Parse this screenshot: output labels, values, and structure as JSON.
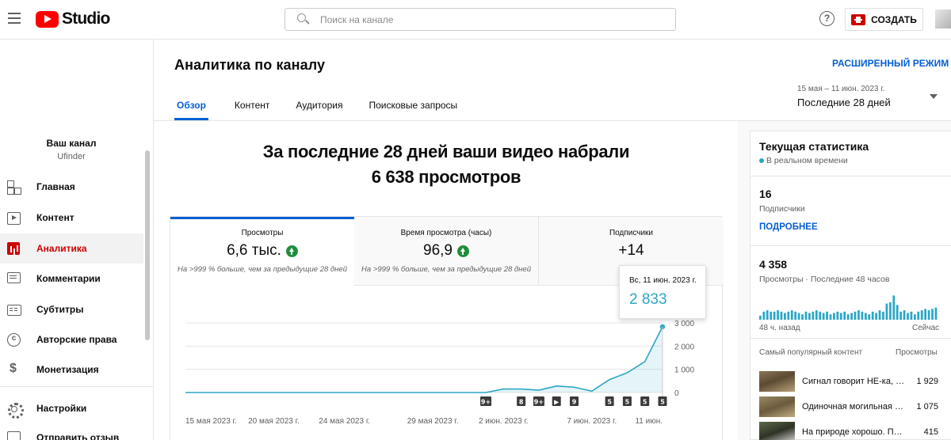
{
  "topbar": {
    "logo_text": "Studio",
    "search_placeholder": "Поиск на канале",
    "help_icon": "?",
    "create_label": "СОЗДАТЬ"
  },
  "sidebar": {
    "channel_name": "Ваш канал",
    "channel_handle": "Ufinder",
    "items": [
      {
        "label": "Главная",
        "icon": "home-icon"
      },
      {
        "label": "Контент",
        "icon": "content-icon"
      },
      {
        "label": "Аналитика",
        "icon": "analytics-icon",
        "active": true
      },
      {
        "label": "Комментарии",
        "icon": "comments-icon"
      },
      {
        "label": "Субтитры",
        "icon": "subtitles-icon"
      },
      {
        "label": "Авторские права",
        "icon": "copyright-icon"
      },
      {
        "label": "Монетизация",
        "icon": "monetization-icon"
      },
      {
        "label": "Настройки",
        "icon": "gear-icon"
      },
      {
        "label": "Отправить отзыв",
        "icon": "feedback-icon"
      }
    ]
  },
  "header": {
    "title": "Аналитика по каналу",
    "advanced_link": "РАСШИРЕННЫЙ РЕЖИМ",
    "tabs": [
      "Обзор",
      "Контент",
      "Аудитория",
      "Поисковые запросы"
    ],
    "date_range": "15 мая – 11 июн. 2023 г.",
    "period": "Последние 28 дней"
  },
  "overview": {
    "headline_line1": "За последние 28 дней ваши видео набрали",
    "headline_line2": "6 638 просмотров",
    "metrics": [
      {
        "title": "Просмотры",
        "value": "6,6 тыс.",
        "trend": "up",
        "compare": "На >999 % больше, чем за предыдущие 28 дней"
      },
      {
        "title": "Время просмотра (часы)",
        "value": "96,9",
        "trend": "up",
        "compare": "На >999 % больше, чем за предыдущие 28 дней"
      },
      {
        "title": "Подписчики",
        "value": "+14"
      }
    ],
    "tooltip": {
      "date": "Вс, 11 июн. 2023 г.",
      "value": "2 833"
    }
  },
  "chart_data": {
    "type": "area",
    "x": [
      "15 мая",
      "16 мая",
      "17 мая",
      "18 мая",
      "19 мая",
      "20 мая",
      "21 мая",
      "22 мая",
      "23 мая",
      "24 мая",
      "25 мая",
      "26 мая",
      "27 мая",
      "28 мая",
      "29 мая",
      "30 мая",
      "31 мая",
      "1 июн.",
      "2 июн.",
      "3 июн.",
      "4 июн.",
      "5 июн.",
      "6 июн.",
      "7 июн.",
      "8 июн.",
      "9 июн.",
      "10 июн.",
      "11 июн."
    ],
    "values": [
      0,
      0,
      0,
      0,
      0,
      0,
      0,
      0,
      0,
      0,
      0,
      0,
      0,
      0,
      0,
      0,
      0,
      0,
      150,
      150,
      100,
      280,
      230,
      60,
      560,
      850,
      1330,
      2833
    ],
    "ylim": [
      0,
      3000
    ],
    "y_ticks": [
      "0",
      "1 000",
      "2 000",
      "3 000"
    ],
    "x_tick_labels": [
      "15 мая 2023 г.",
      "20 мая 2023 г.",
      "24 мая 2023 г.",
      "29 мая 2023 г.",
      "2 июн. 2023 г.",
      "7 июн. 2023 г.",
      "11 июн."
    ],
    "event_markers": [
      "9+",
      "8",
      "9+",
      "▶",
      "9",
      "5",
      "5",
      "5",
      "5"
    ],
    "line_color": "#2ba6c6"
  },
  "realtime": {
    "title": "Текущая статистика",
    "live_label": "В реальном времени",
    "subscribers_value": "16",
    "subscribers_label": "Подписчики",
    "more_link": "ПОДРОБНЕЕ",
    "views_value": "4 358",
    "views_label": "Просмотры · Последние 48 часов",
    "axis_start": "48 ч. назад",
    "axis_end": "Сейчас",
    "bars": [
      0.15,
      0.3,
      0.35,
      0.3,
      0.3,
      0.35,
      0.3,
      0.25,
      0.3,
      0.35,
      0.3,
      0.25,
      0.2,
      0.3,
      0.25,
      0.3,
      0.35,
      0.3,
      0.25,
      0.3,
      0.2,
      0.25,
      0.3,
      0.25,
      0.3,
      0.2,
      0.25,
      0.3,
      0.35,
      0.3,
      0.25,
      0.2,
      0.3,
      0.25,
      0.35,
      0.3,
      0.6,
      0.65,
      0.9,
      0.55,
      0.3,
      0.35,
      0.25,
      0.3,
      0.2,
      0.3,
      0.35,
      0.4,
      0.35,
      0.4,
      0.45
    ],
    "bar_color": "#2ba6c6",
    "top_content_label": "Самый популярный контент",
    "top_views_label": "Просмотры",
    "videos": [
      {
        "title": "Сигнал говорит НЕ-ка, н…",
        "views": "1 929"
      },
      {
        "title": "Одиночная могильная о…",
        "views": "1 075"
      },
      {
        "title": "На природе хорошо. Перв…",
        "views": "415"
      }
    ]
  }
}
